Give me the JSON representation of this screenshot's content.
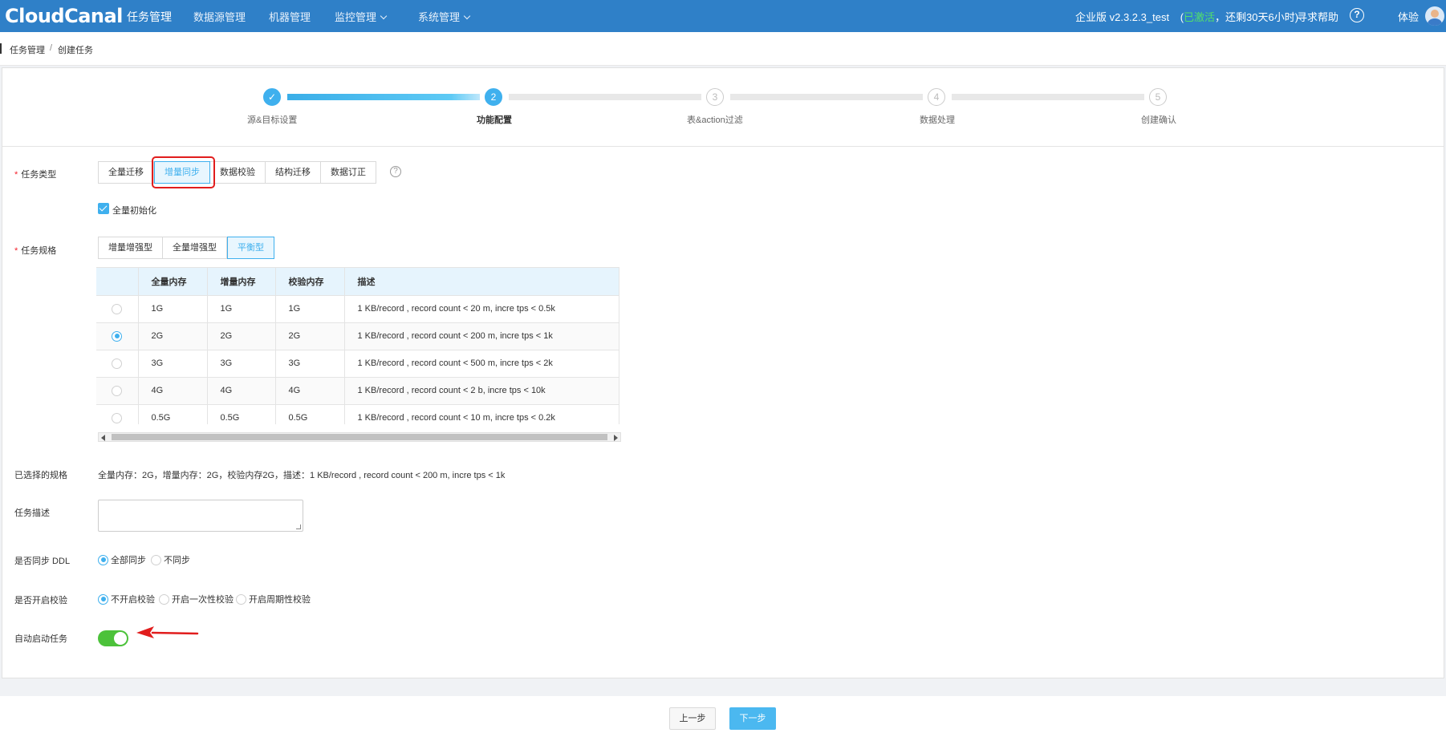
{
  "header": {
    "logo": "CloudCanal",
    "nav": [
      "任务管理",
      "数据源管理",
      "机器管理",
      "监控管理",
      "系统管理"
    ],
    "edition": "企业版 v2.3.2.3_test",
    "paren_open": "(",
    "activated": "已激活",
    "remaining": "，还剩30天6小时)",
    "help_link": "寻求帮助",
    "help_icon": "?",
    "user": "体验"
  },
  "breadcrumb": {
    "root": "任务管理",
    "sep": "/",
    "current": "创建任务"
  },
  "steps": [
    {
      "num": "✓",
      "label": "源&目标设置",
      "state": "done"
    },
    {
      "num": "2",
      "label": "功能配置",
      "state": "current"
    },
    {
      "num": "3",
      "label": "表&action过滤",
      "state": "todo"
    },
    {
      "num": "4",
      "label": "数据处理",
      "state": "todo"
    },
    {
      "num": "5",
      "label": "创建确认",
      "state": "todo"
    }
  ],
  "form": {
    "task_type_label": "任务类型",
    "task_types": [
      "全量迁移",
      "增量同步",
      "数据校验",
      "结构迁移",
      "数据订正"
    ],
    "task_type_selected": "增量同步",
    "full_init_label": "全量初始化",
    "spec_label": "任务规格",
    "specs": [
      "增量增强型",
      "全量增强型",
      "平衡型"
    ],
    "spec_selected": "平衡型",
    "table": {
      "headers": [
        "",
        "全量内存",
        "增量内存",
        "校验内存",
        "描述"
      ],
      "rows": [
        {
          "full": "1G",
          "incr": "1G",
          "check": "1G",
          "desc": "1 KB/record , record count < 20 m, incre tps < 0.5k",
          "selected": false
        },
        {
          "full": "2G",
          "incr": "2G",
          "check": "2G",
          "desc": "1 KB/record , record count < 200 m, incre tps < 1k",
          "selected": true
        },
        {
          "full": "3G",
          "incr": "3G",
          "check": "3G",
          "desc": "1 KB/record , record count < 500 m, incre tps < 2k",
          "selected": false
        },
        {
          "full": "4G",
          "incr": "4G",
          "check": "4G",
          "desc": "1 KB/record , record count < 2 b, incre tps < 10k",
          "selected": false
        },
        {
          "full": "0.5G",
          "incr": "0.5G",
          "check": "0.5G",
          "desc": "1 KB/record , record count < 10 m, incre tps < 0.2k",
          "selected": false
        }
      ]
    },
    "selected_spec_label": "已选择的规格",
    "selected_spec_value": "全量内存：2G，增量内存：2G，校验内存2G，描述：1 KB/record , record count < 200 m, incre tps < 1k",
    "desc_label": "任务描述",
    "desc_value": "",
    "ddl_label": "是否同步 DDL",
    "ddl_options": [
      "全部同步",
      "不同步"
    ],
    "check_label": "是否开启校验",
    "check_options": [
      "不开启校验",
      "开启一次性校验",
      "开启周期性校验"
    ],
    "autostart_label": "自动启动任务",
    "autostart_on": true
  },
  "footer": {
    "prev": "上一步",
    "next": "下一步"
  },
  "colors": {
    "primary": "#2f80c8",
    "accent": "#3fb0ee",
    "toggle": "#4cc23a",
    "annotation": "#e11d1d"
  }
}
